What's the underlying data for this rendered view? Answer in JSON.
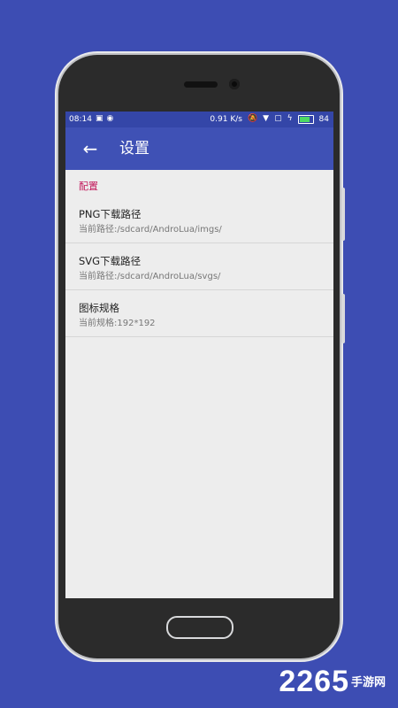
{
  "status_bar": {
    "time": "08:14",
    "net_speed": "0.91 K/s",
    "battery": "84",
    "icons": [
      "image-icon",
      "check-circle-icon",
      "mute-icon",
      "wifi-icon",
      "no-sim-icon",
      "charging-icon",
      "battery-icon"
    ]
  },
  "app_bar": {
    "back_icon": "arrow-left-icon",
    "title": "设置"
  },
  "settings": {
    "category": "配置",
    "items": [
      {
        "title": "PNG下载路径",
        "summary": "当前路径:/sdcard/AndroLua/imgs/"
      },
      {
        "title": "SVG下载路径",
        "summary": "当前路径:/sdcard/AndroLua/svgs/"
      },
      {
        "title": "图标规格",
        "summary": "当前规格:192*192"
      }
    ]
  },
  "colors": {
    "background": "#3d4db3",
    "app_bar": "#3f51b5",
    "status_bar": "#3446a8",
    "category_text": "#c2185b",
    "screen_bg": "#ededed"
  },
  "watermark": {
    "number": "2265",
    "text": "手游网"
  }
}
